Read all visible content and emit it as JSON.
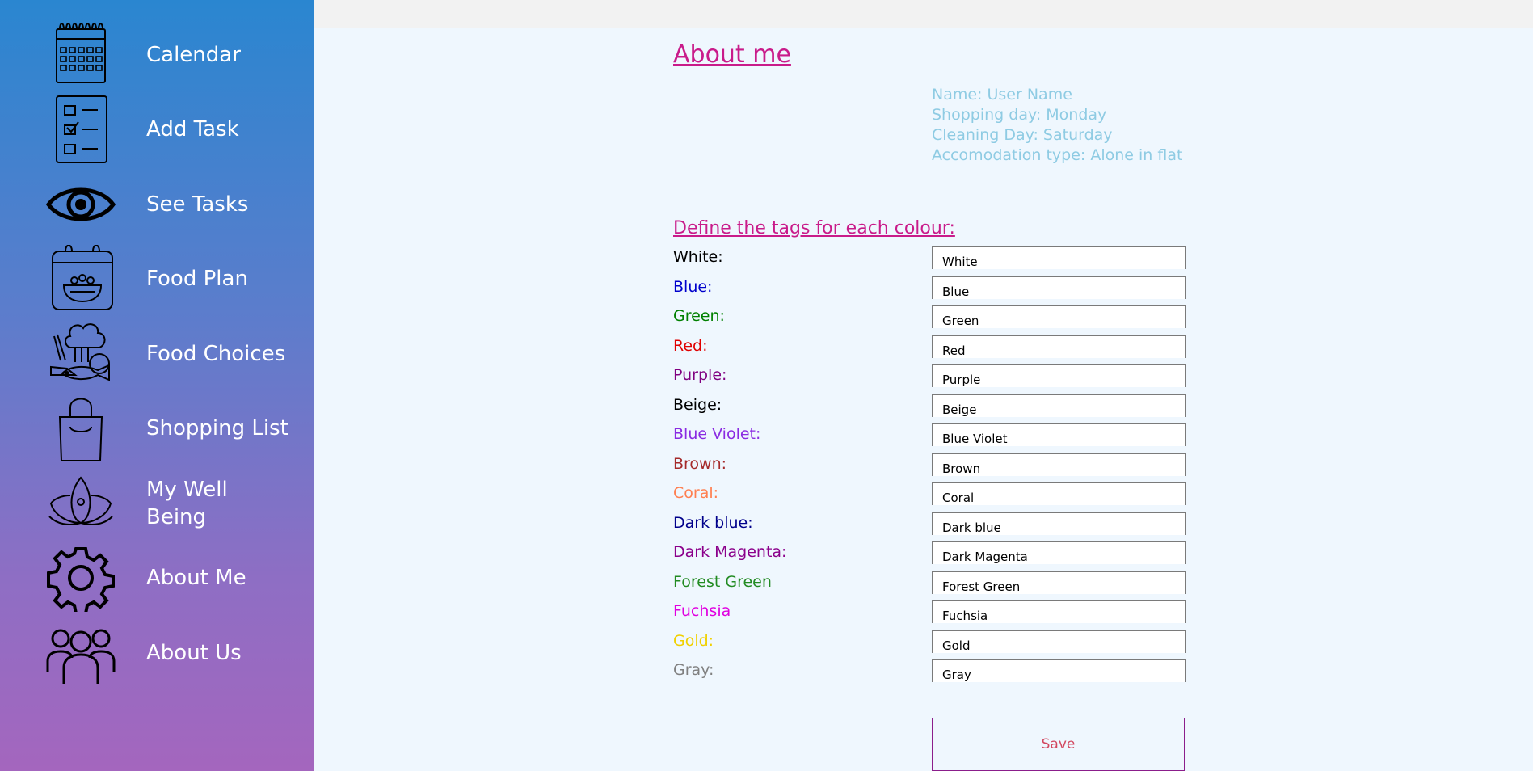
{
  "sidebar": {
    "items": [
      {
        "label": "Calendar",
        "icon": "calendar-icon"
      },
      {
        "label": "Add Task",
        "icon": "checklist-icon"
      },
      {
        "label": "See Tasks",
        "icon": "eye-icon"
      },
      {
        "label": "Food Plan",
        "icon": "food-plan-icon"
      },
      {
        "label": "Food Choices",
        "icon": "food-choices-icon"
      },
      {
        "label": "Shopping List",
        "icon": "shopping-bag-icon"
      },
      {
        "label": "My Well Being",
        "icon": "lotus-icon"
      },
      {
        "label": "About Me",
        "icon": "gear-icon"
      },
      {
        "label": "About Us",
        "icon": "people-icon"
      }
    ]
  },
  "main": {
    "title": "About me",
    "info": {
      "name": "Name: User Name",
      "shopping_day": "Shopping day: Monday",
      "cleaning_day": "Cleaning Day: Saturday",
      "accommodation": "Accomodation type: Alone in flat"
    },
    "tags_heading": "Define the tags for each colour:",
    "tags": [
      {
        "label": "White:",
        "value": "White",
        "color": "#000000"
      },
      {
        "label": "Blue:",
        "value": "Blue",
        "color": "#0000cc"
      },
      {
        "label": "Green:",
        "value": "Green",
        "color": "#008000"
      },
      {
        "label": "Red:",
        "value": "Red",
        "color": "#e00000"
      },
      {
        "label": "Purple:",
        "value": "Purple",
        "color": "#800080"
      },
      {
        "label": "Beige:",
        "value": "Beige",
        "color": "#000000"
      },
      {
        "label": "Blue Violet:",
        "value": "Blue Violet",
        "color": "#8a2be2"
      },
      {
        "label": "Brown:",
        "value": "Brown",
        "color": "#a52a2a"
      },
      {
        "label": "Coral:",
        "value": "Coral",
        "color": "#ff7f50"
      },
      {
        "label": "Dark blue:",
        "value": "Dark blue",
        "color": "#00008b"
      },
      {
        "label": "Dark Magenta:",
        "value": "Dark Magenta",
        "color": "#8b008b"
      },
      {
        "label": "Forest Green",
        "value": "Forest Green",
        "color": "#228b22"
      },
      {
        "label": "Fuchsia",
        "value": "Fuchsia",
        "color": "#e000e0"
      },
      {
        "label": "Gold:",
        "value": "Gold",
        "color": "#f0d000"
      },
      {
        "label": "Gray:",
        "value": "Gray",
        "color": "#808080"
      }
    ],
    "save_label": "Save"
  },
  "colors": {
    "accent": "#c91b8a",
    "info_text": "#8ecbe3",
    "save_text": "#d2475f",
    "sidebar_top": "#2a86d0",
    "sidebar_bottom": "#a466be"
  }
}
